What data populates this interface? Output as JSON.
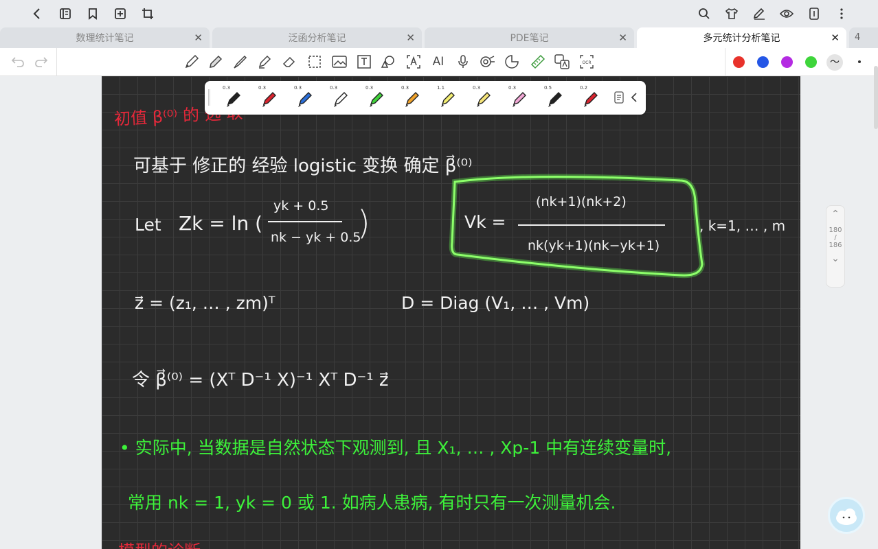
{
  "tabs": [
    {
      "label": "数理统计笔记"
    },
    {
      "label": "泛函分析笔记"
    },
    {
      "label": "PDE笔记"
    },
    {
      "label": "多元统计分析笔记"
    }
  ],
  "tab_count": "4",
  "pens": [
    {
      "size": "0.3",
      "color": "#222222"
    },
    {
      "size": "0.3",
      "color": "#d9242f"
    },
    {
      "size": "0.3",
      "color": "#2b6fd8"
    },
    {
      "size": "0.3",
      "color": "#ffffff"
    },
    {
      "size": "0.3",
      "color": "#3fd23a"
    },
    {
      "size": "0.3",
      "color": "#f0a22a"
    },
    {
      "size": "1.1",
      "color": "#f3ee72"
    },
    {
      "size": "0.3",
      "color": "#f6e57a"
    },
    {
      "size": "0.3",
      "color": "#f2a8d6"
    },
    {
      "size": "0.5",
      "color": "#222222"
    },
    {
      "size": "0.2",
      "color": "#d9242f"
    }
  ],
  "palette": [
    "#e8322b",
    "#2456e6",
    "#b42be2",
    "#3ed53b"
  ],
  "pager": {
    "current": "180",
    "sep": "/",
    "total": "186"
  },
  "note": {
    "red_heading": "初值 β⁽⁰⁾ 的 选 取",
    "line1": "可基于 修正的 经验 logistic 变换 确定 β⃗⁽⁰⁾",
    "let": "Let",
    "zk": "Zk = ln (",
    "frac_num": "yk + 0.5",
    "frac_den": "nk − yk + 0.5",
    "close_paren": ")",
    "vk": "Vk =",
    "v_num": "(nk+1)(nk+2)",
    "v_den": "nk(yk+1)(nk−yk+1)",
    "k_range": ", k=1, … , m",
    "zvec": "z⃗ = (z₁, … , zm)ᵀ",
    "dmat": "D = Diag (V₁, … , Vm)",
    "beta_def": "令 β⃗⁽⁰⁾ = (Xᵀ D⁻¹ X)⁻¹ Xᵀ D⁻¹ z⃗",
    "green1": "• 实际中, 当数据是自然状态下观测到, 且 X₁, … , Xp-1 中有连续变量时,",
    "green2": "常用 nk = 1,  yk = 0 或 1.  如病人患病, 有时只有一次测量机会."
  }
}
